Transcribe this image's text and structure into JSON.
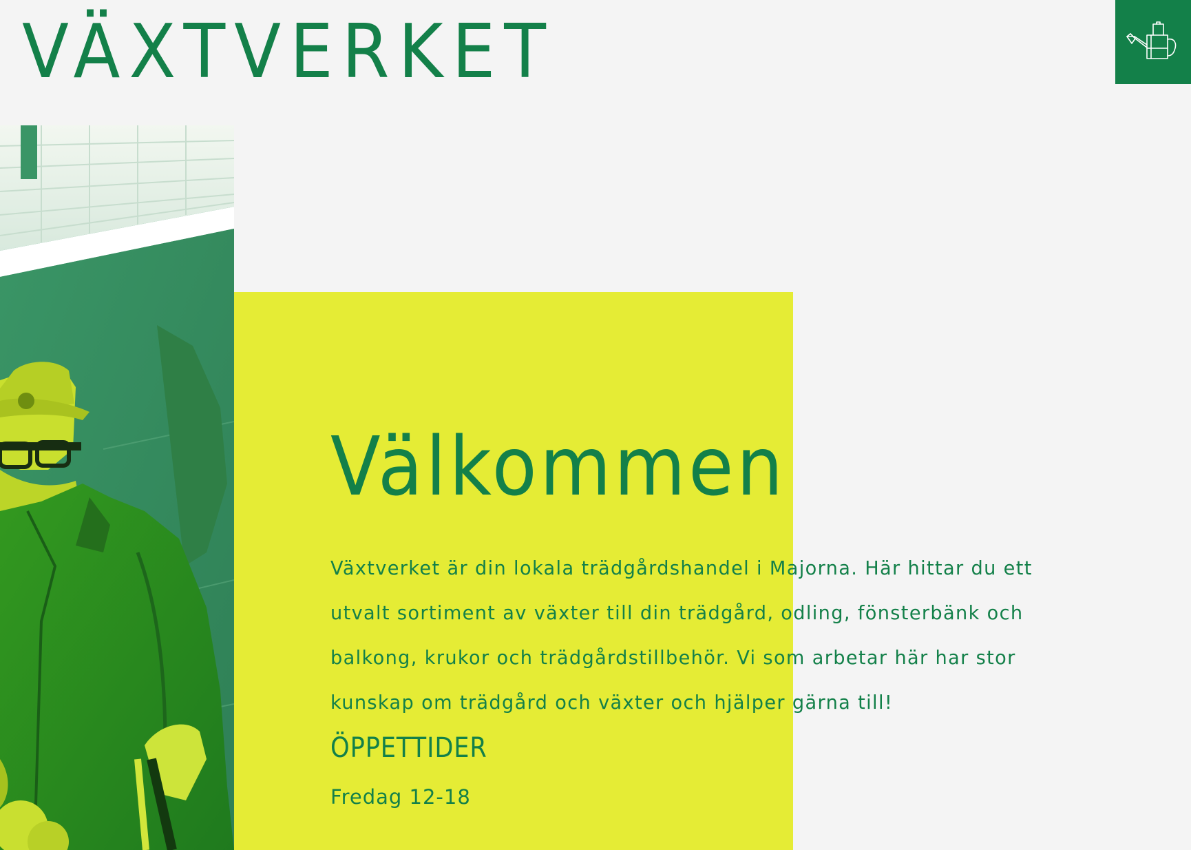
{
  "header": {
    "logo_text": "VÄXTVERKET",
    "menu_icon": "watering-can-icon"
  },
  "colors": {
    "brand_green": "#138049",
    "accent_yellow": "#e5ec35",
    "background": "#f4f4f4"
  },
  "main": {
    "title": "Välkommen",
    "intro": "Växtverket är din lokala trädgårdshandel i Majorna. Här hittar du ett utvalt sortiment av växter till din trädgård, odling, fönsterbänk och balkong, krukor och trädgårdstillbehör. Vi som arbetar här har stor kunskap om trädgård och växter och hjälper gärna till!",
    "hours_heading": "ÖPPETTIDER",
    "hours": [
      "Fredag 12-18"
    ]
  }
}
